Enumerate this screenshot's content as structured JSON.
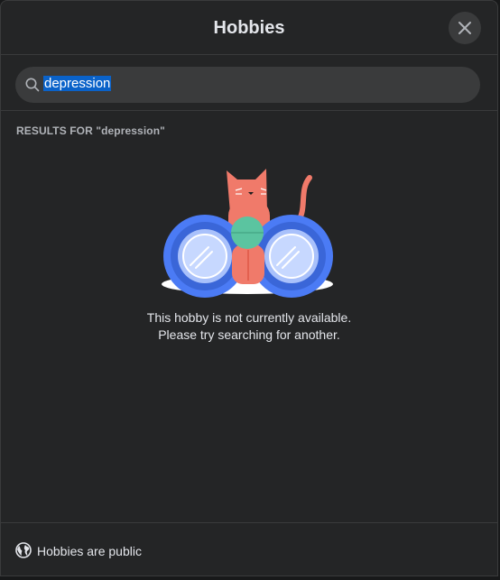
{
  "dialog": {
    "title": "Hobbies",
    "close_icon": "close-icon"
  },
  "search": {
    "value": "depression",
    "icon": "search-icon"
  },
  "results": {
    "label_prefix": "RESULTS FOR ",
    "query": "\"depression\""
  },
  "empty_state": {
    "illustration": "cat-binoculars-illustration",
    "line1": "This hobby is not currently available.",
    "line2": "Please try searching for another."
  },
  "footer": {
    "icon": "globe-icon",
    "text": "Hobbies are public"
  },
  "colors": {
    "background": "#242526",
    "divider": "#3a3b3c",
    "text_primary": "#e4e6eb",
    "text_secondary": "#b0b3b8",
    "selection": "#0a62c9",
    "cat": "#f07a6a",
    "binocular_blue": "#4b7bf5",
    "lens_green": "#5bc4a0"
  }
}
